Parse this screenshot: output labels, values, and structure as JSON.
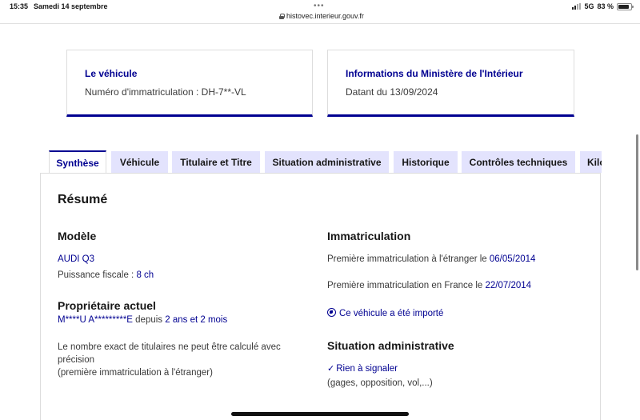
{
  "status_bar": {
    "time": "15:35",
    "date": "Samedi 14 septembre",
    "url": "histovec.interieur.gouv.fr",
    "network": "5G",
    "battery": "83 %"
  },
  "cards": {
    "vehicle": {
      "title": "Le véhicule",
      "text": "Numéro d'immatriculation : DH-7**-VL"
    },
    "ministry": {
      "title": "Informations du Ministère de l'Intérieur",
      "text": "Datant du 13/09/2024"
    }
  },
  "tabs": [
    {
      "label": "Synthèse",
      "active": true
    },
    {
      "label": "Véhicule",
      "active": false
    },
    {
      "label": "Titulaire et Titre",
      "active": false
    },
    {
      "label": "Situation administrative",
      "active": false
    },
    {
      "label": "Historique",
      "active": false
    },
    {
      "label": "Contrôles techniques",
      "active": false
    },
    {
      "label": "Kilo",
      "active": false
    }
  ],
  "resume": {
    "heading": "Résumé",
    "modele": {
      "heading": "Modèle",
      "model": "AUDI Q3",
      "fiscal_label": "Puissance fiscale : ",
      "fiscal_value": "8 ch"
    },
    "proprietaire": {
      "heading": "Propriétaire actuel",
      "name": "M****U A*********E",
      "since_label": " depuis ",
      "since_value": "2 ans et 2 mois",
      "note_line1": "Le nombre exact de titulaires ne peut être calculé avec",
      "note_line2": "précision",
      "note_line3": "(première immatriculation à l'étranger)"
    },
    "immatriculation": {
      "heading": "Immatriculation",
      "foreign_label": "Première immatriculation à l'étranger le ",
      "foreign_date": "06/05/2014",
      "france_label": "Première immatriculation en France le ",
      "france_date": "22/07/2014",
      "imported": "Ce véhicule a été importé"
    },
    "situation": {
      "heading": "Situation administrative",
      "status": "Rien à signaler",
      "detail": "(gages, opposition, vol,...)"
    }
  },
  "colors": {
    "accent": "#000091",
    "tab_inactive": "#e3e3fd"
  }
}
